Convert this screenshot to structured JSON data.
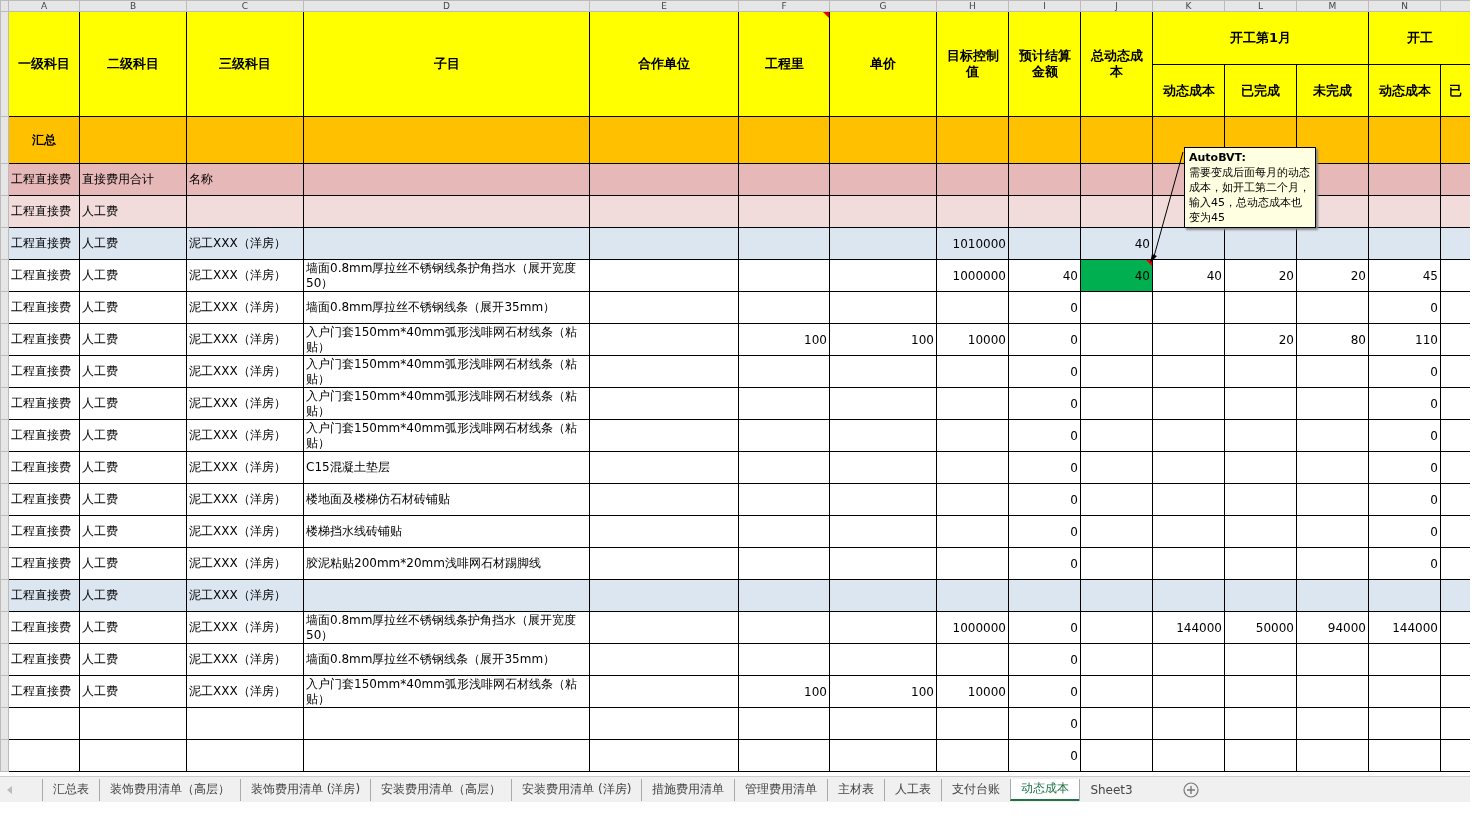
{
  "column_letters": [
    "A",
    "B",
    "C",
    "D",
    "E",
    "F",
    "G",
    "H",
    "I",
    "J",
    "K",
    "L",
    "M",
    "N"
  ],
  "columns": [
    {
      "title": "一级科目"
    },
    {
      "title": "二级科目"
    },
    {
      "title": "三级科目"
    },
    {
      "title": "子目"
    },
    {
      "title": "合作单位"
    },
    {
      "title": "工程里",
      "comment": true
    },
    {
      "title": "单价"
    },
    {
      "title": "目标控制值"
    },
    {
      "title": "预计结算金额"
    },
    {
      "title": "总动态成本"
    }
  ],
  "column_groups": [
    {
      "title": "开工第1月",
      "columns": [
        "动态成本",
        "已完成",
        "未完成"
      ]
    },
    {
      "title": "开工",
      "columns": [
        "动态成本",
        "已"
      ]
    }
  ],
  "rows": [
    {
      "kind": "summary",
      "cells": {
        "A": "汇总"
      }
    },
    {
      "kind": "total",
      "cells": {
        "A": "工程直接费",
        "B": "直接费用合计",
        "C": "名称"
      }
    },
    {
      "kind": "subtotal",
      "cells": {
        "A": "工程直接费",
        "B": "人工费"
      }
    },
    {
      "kind": "group",
      "cells": {
        "A": "工程直接费",
        "B": "人工费",
        "C": "泥工XXX（洋房）",
        "H": "1010000",
        "J": "40"
      }
    },
    {
      "kind": "item",
      "cells": {
        "A": "工程直接费",
        "B": "人工费",
        "C": "泥工XXX（洋房）",
        "D": "墙面0.8mm厚拉丝不锈钢线条护角挡水（展开宽度50）",
        "H": "1000000",
        "I": "40",
        "J": {
          "text": "40",
          "color": "#00b050",
          "comment": {
            "author": "AutoBVT:",
            "text": "需要变成后面每月的动态成本，如开工第二个月，输入45，总动态成本也变为45"
          }
        },
        "K": "40",
        "L": "20",
        "M": "20",
        "N": "45"
      }
    },
    {
      "kind": "item",
      "cells": {
        "A": "工程直接费",
        "B": "人工费",
        "C": "泥工XXX（洋房）",
        "D": "墙面0.8mm厚拉丝不锈钢线条（展开35mm）",
        "I": "0",
        "N": "0"
      }
    },
    {
      "kind": "item",
      "cells": {
        "A": "工程直接费",
        "B": "人工费",
        "C": "泥工XXX（洋房）",
        "D": "入户门套150mm*40mm弧形浅啡网石材线条（粘贴）",
        "F": "100",
        "G": "100",
        "H": "10000",
        "I": "0",
        "L": "20",
        "M": "80",
        "N": "110"
      }
    },
    {
      "kind": "item",
      "cells": {
        "A": "工程直接费",
        "B": "人工费",
        "C": "泥工XXX（洋房）",
        "D": "入户门套150mm*40mm弧形浅啡网石材线条（粘贴）",
        "I": "0",
        "N": "0"
      }
    },
    {
      "kind": "item",
      "cells": {
        "A": "工程直接费",
        "B": "人工费",
        "C": "泥工XXX（洋房）",
        "D": "入户门套150mm*40mm弧形浅啡网石材线条（粘贴）",
        "I": "0",
        "N": "0"
      }
    },
    {
      "kind": "item",
      "cells": {
        "A": "工程直接费",
        "B": "人工费",
        "C": "泥工XXX（洋房）",
        "D": "入户门套150mm*40mm弧形浅啡网石材线条（粘贴）",
        "I": "0",
        "N": "0"
      }
    },
    {
      "kind": "item",
      "cells": {
        "A": "工程直接费",
        "B": "人工费",
        "C": "泥工XXX（洋房）",
        "D": "C15混凝土垫层",
        "I": "0",
        "N": "0"
      }
    },
    {
      "kind": "item",
      "cells": {
        "A": "工程直接费",
        "B": "人工费",
        "C": "泥工XXX（洋房）",
        "D": "楼地面及楼梯仿石材砖铺贴",
        "I": "0",
        "N": "0"
      }
    },
    {
      "kind": "item",
      "cells": {
        "A": "工程直接费",
        "B": "人工费",
        "C": "泥工XXX（洋房）",
        "D": "楼梯挡水线砖铺贴",
        "I": "0",
        "N": "0"
      }
    },
    {
      "kind": "item",
      "cells": {
        "A": "工程直接费",
        "B": "人工费",
        "C": "泥工XXX（洋房）",
        "D": "胶泥粘贴200mm*20mm浅啡网石材踢脚线",
        "I": "0",
        "N": "0"
      }
    },
    {
      "kind": "group",
      "cells": {
        "A": "工程直接费",
        "B": "人工费",
        "C": "泥工XXX（洋房）"
      }
    },
    {
      "kind": "item",
      "cells": {
        "A": "工程直接费",
        "B": "人工费",
        "C": "泥工XXX（洋房）",
        "D": "墙面0.8mm厚拉丝不锈钢线条护角挡水（展开宽度50）",
        "H": "1000000",
        "I": "0",
        "K": "144000",
        "L": "50000",
        "M": "94000",
        "N": "144000"
      }
    },
    {
      "kind": "item",
      "cells": {
        "A": "工程直接费",
        "B": "人工费",
        "C": "泥工XXX（洋房）",
        "D": "墙面0.8mm厚拉丝不锈钢线条（展开35mm）",
        "I": "0"
      }
    },
    {
      "kind": "item",
      "cells": {
        "A": "工程直接费",
        "B": "人工费",
        "C": "泥工XXX（洋房）",
        "D": "入户门套150mm*40mm弧形浅啡网石材线条（粘贴）",
        "F": "100",
        "G": "100",
        "H": "10000",
        "I": "0"
      }
    },
    {
      "kind": "item",
      "cells": {
        "I": "0"
      }
    },
    {
      "kind": "item",
      "cells": {
        "I": "0"
      }
    }
  ],
  "sheet_tabs": [
    {
      "label": "汇总表",
      "selected": false
    },
    {
      "label": "装饰费用清单（高层）",
      "selected": false
    },
    {
      "label": "装饰费用清单 (洋房)",
      "selected": false
    },
    {
      "label": "安装费用清单（高层）",
      "selected": false
    },
    {
      "label": "安装费用清单 (洋房)",
      "selected": false
    },
    {
      "label": "措施费用清单",
      "selected": false
    },
    {
      "label": "管理费用清单",
      "selected": false
    },
    {
      "label": "主材表",
      "selected": false
    },
    {
      "label": "人工表",
      "selected": false
    },
    {
      "label": "支付台账",
      "selected": false
    },
    {
      "label": "动态成本",
      "selected": true
    },
    {
      "label": "Sheet3",
      "selected": false
    }
  ]
}
